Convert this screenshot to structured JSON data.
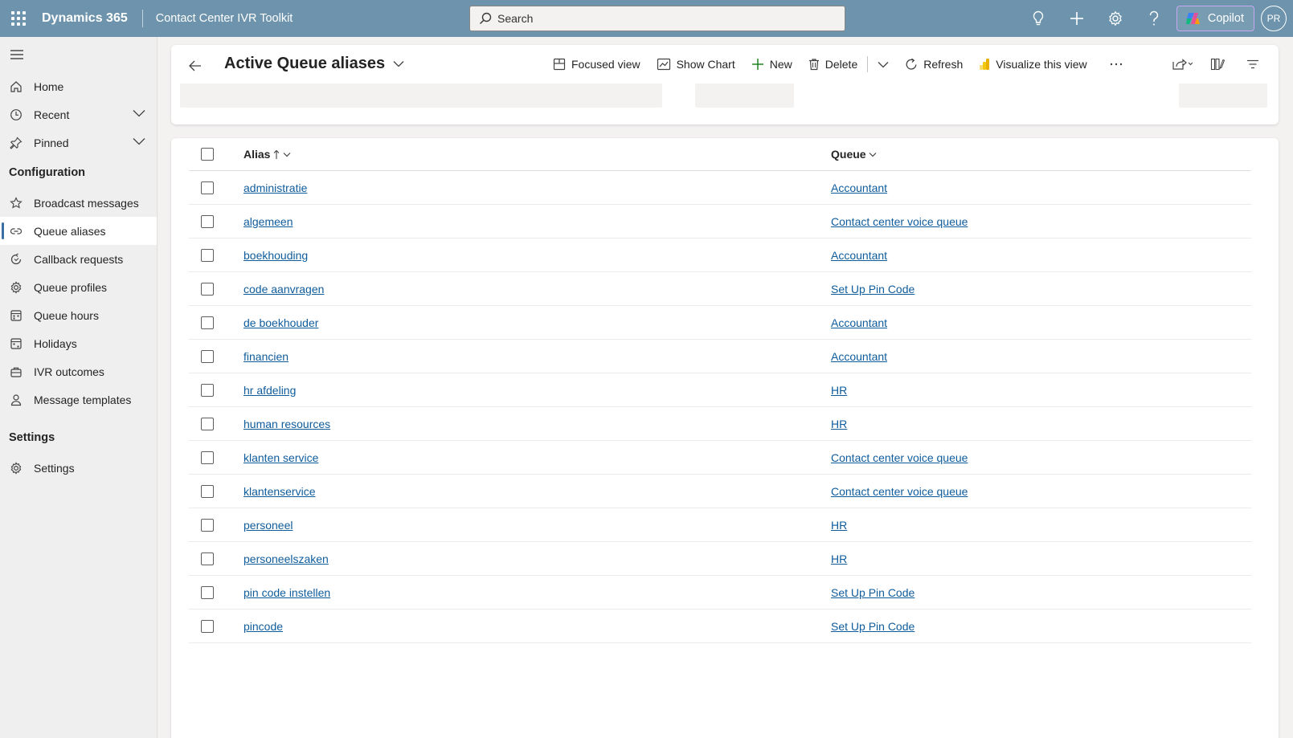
{
  "header": {
    "brand": "Dynamics 365",
    "app_name": "Contact Center IVR Toolkit",
    "search_placeholder": "Search",
    "copilot_label": "Copilot",
    "avatar_initials": "PR"
  },
  "sidebar": {
    "top_items": [
      {
        "label": "Home"
      },
      {
        "label": "Recent"
      },
      {
        "label": "Pinned"
      }
    ],
    "configuration_title": "Configuration",
    "configuration_items": [
      {
        "label": "Broadcast messages"
      },
      {
        "label": "Queue aliases"
      },
      {
        "label": "Callback requests"
      },
      {
        "label": "Queue profiles"
      },
      {
        "label": "Queue hours"
      },
      {
        "label": "Holidays"
      },
      {
        "label": "IVR outcomes"
      },
      {
        "label": "Message templates"
      }
    ],
    "settings_title": "Settings",
    "settings_items": [
      {
        "label": "Settings"
      }
    ]
  },
  "commandbar": {
    "view_title": "Active Queue aliases",
    "focused_view": "Focused view",
    "show_chart": "Show Chart",
    "new": "New",
    "delete": "Delete",
    "refresh": "Refresh",
    "visualize": "Visualize this view"
  },
  "grid": {
    "columns": {
      "alias": "Alias",
      "queue": "Queue"
    },
    "rows": [
      {
        "alias": "administratie",
        "queue": "Accountant"
      },
      {
        "alias": "algemeen",
        "queue": "Contact center voice queue"
      },
      {
        "alias": "boekhouding",
        "queue": "Accountant"
      },
      {
        "alias": "code aanvragen",
        "queue": "Set Up Pin Code"
      },
      {
        "alias": "de boekhouder",
        "queue": "Accountant"
      },
      {
        "alias": "financien",
        "queue": "Accountant"
      },
      {
        "alias": "hr afdeling",
        "queue": "HR"
      },
      {
        "alias": "human resources",
        "queue": "HR"
      },
      {
        "alias": "klanten service",
        "queue": "Contact center voice queue"
      },
      {
        "alias": "klantenservice",
        "queue": "Contact center voice queue"
      },
      {
        "alias": "personeel",
        "queue": "HR"
      },
      {
        "alias": "personeelszaken",
        "queue": "HR"
      },
      {
        "alias": "pin code instellen",
        "queue": "Set Up Pin Code"
      },
      {
        "alias": "pincode",
        "queue": "Set Up Pin Code"
      }
    ]
  },
  "colors": {
    "header_bg": "#6d94ac",
    "link": "#0f5c9c",
    "active_indicator": "#3a6ea5"
  }
}
